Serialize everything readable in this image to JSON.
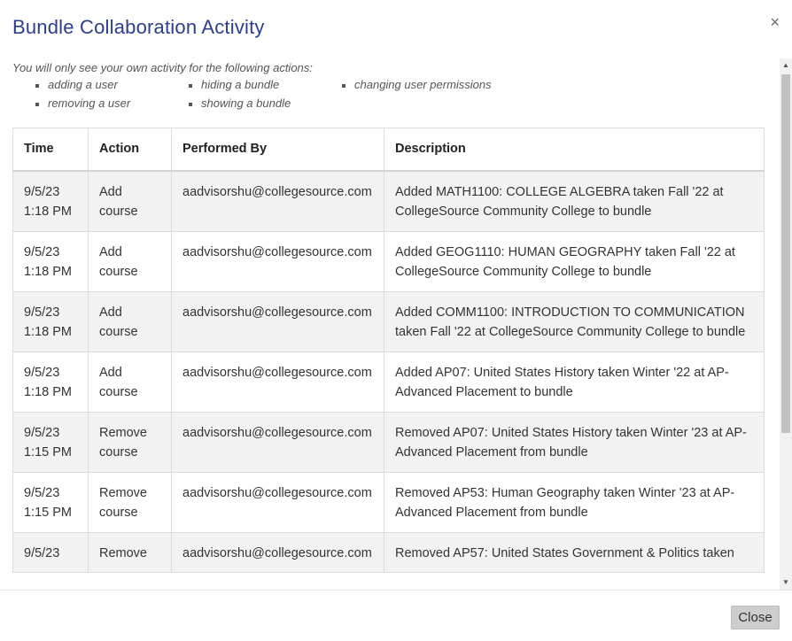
{
  "dialog": {
    "title": "Bundle Collaboration Activity",
    "close_icon": "×",
    "note": "You will only see your own activity for the following actions:",
    "actions_list": [
      "adding a user",
      "removing a user",
      "hiding a bundle",
      "showing a bundle",
      "changing user permissions"
    ],
    "close_button": "Close"
  },
  "table": {
    "headers": {
      "time": "Time",
      "action": "Action",
      "performed_by": "Performed By",
      "description": "Description"
    },
    "rows": [
      {
        "date": "9/5/23",
        "clock": "1:18 PM",
        "action_1": "Add",
        "action_2": "course",
        "by": "aadvisorshu@collegesource.com",
        "description": "Added MATH1100: COLLEGE ALGEBRA taken Fall '22 at CollegeSource Community College to bundle"
      },
      {
        "date": "9/5/23",
        "clock": "1:18 PM",
        "action_1": "Add",
        "action_2": "course",
        "by": "aadvisorshu@collegesource.com",
        "description": "Added GEOG1110: HUMAN GEOGRAPHY taken Fall '22 at CollegeSource Community College to bundle"
      },
      {
        "date": "9/5/23",
        "clock": "1:18 PM",
        "action_1": "Add",
        "action_2": "course",
        "by": "aadvisorshu@collegesource.com",
        "description": "Added COMM1100: INTRODUCTION TO COMMUNICATION taken Fall '22 at CollegeSource Community College to bundle"
      },
      {
        "date": "9/5/23",
        "clock": "1:18 PM",
        "action_1": "Add",
        "action_2": "course",
        "by": "aadvisorshu@collegesource.com",
        "description": "Added AP07: United States History taken Winter '22 at AP-Advanced Placement to bundle"
      },
      {
        "date": "9/5/23",
        "clock": "1:15 PM",
        "action_1": "Remove",
        "action_2": "course",
        "by": "aadvisorshu@collegesource.com",
        "description": "Removed AP07: United States History taken Winter '23 at AP-Advanced Placement from bundle"
      },
      {
        "date": "9/5/23",
        "clock": "1:15 PM",
        "action_1": "Remove",
        "action_2": "course",
        "by": "aadvisorshu@collegesource.com",
        "description": "Removed AP53: Human Geography taken Winter '23 at AP-Advanced Placement from bundle"
      },
      {
        "date": "9/5/23",
        "clock": "",
        "action_1": "Remove",
        "action_2": "",
        "by": "aadvisorshu@collegesource.com",
        "description": "Removed AP57: United States Government & Politics taken"
      }
    ]
  },
  "icons": {
    "scroll_up": "scroll-up-arrow-icon",
    "scroll_down": "scroll-down-arrow-icon"
  }
}
